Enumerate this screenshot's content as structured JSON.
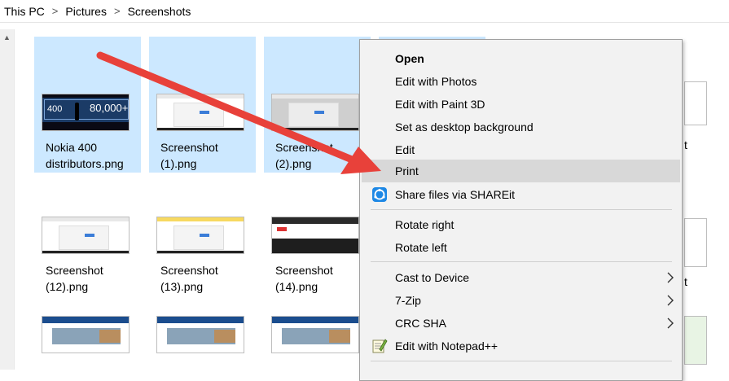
{
  "breadcrumb": {
    "items": [
      "This PC",
      "Pictures",
      "Screenshots"
    ],
    "separator": ">"
  },
  "files": [
    {
      "name": "Nokia 400\ndistributors.png",
      "selected": true,
      "thumb_text_a": "400",
      "thumb_text_b": "80,000+"
    },
    {
      "name": "Screenshot\n(1).png",
      "selected": true
    },
    {
      "name": "Screenshot\n(2).png",
      "selected": true
    },
    {
      "name": "Screenshot\n(12).png",
      "selected": false
    },
    {
      "name": "Screenshot\n(13).png",
      "selected": false
    },
    {
      "name": "Screenshot\n(14).png",
      "selected": false
    }
  ],
  "edge_text": {
    "row1": "t",
    "row2": "t"
  },
  "context_menu": {
    "items": [
      {
        "label": "Open",
        "bold": true
      },
      {
        "label": "Edit with Photos"
      },
      {
        "label": "Edit with Paint 3D"
      },
      {
        "label": "Set as desktop background"
      },
      {
        "label": "Edit"
      },
      {
        "label": "Print",
        "highlighted": true
      },
      {
        "label": "Share files via SHAREit",
        "icon": "shareit-icon"
      },
      {
        "label": "Rotate right"
      },
      {
        "label": "Rotate left"
      },
      {
        "label": "Cast to Device",
        "submenu": true
      },
      {
        "label": "7-Zip",
        "submenu": true
      },
      {
        "label": "CRC SHA",
        "submenu": true
      },
      {
        "label": "Edit with Notepad++",
        "icon": "notepad-plus-plus-icon"
      }
    ]
  },
  "colors": {
    "selection": "#cce8ff",
    "menu_background": "#f2f2f2",
    "menu_highlight": "#d8d8d8",
    "annotation_arrow": "#e8413a",
    "shareit_blue": "#1e88e5"
  }
}
